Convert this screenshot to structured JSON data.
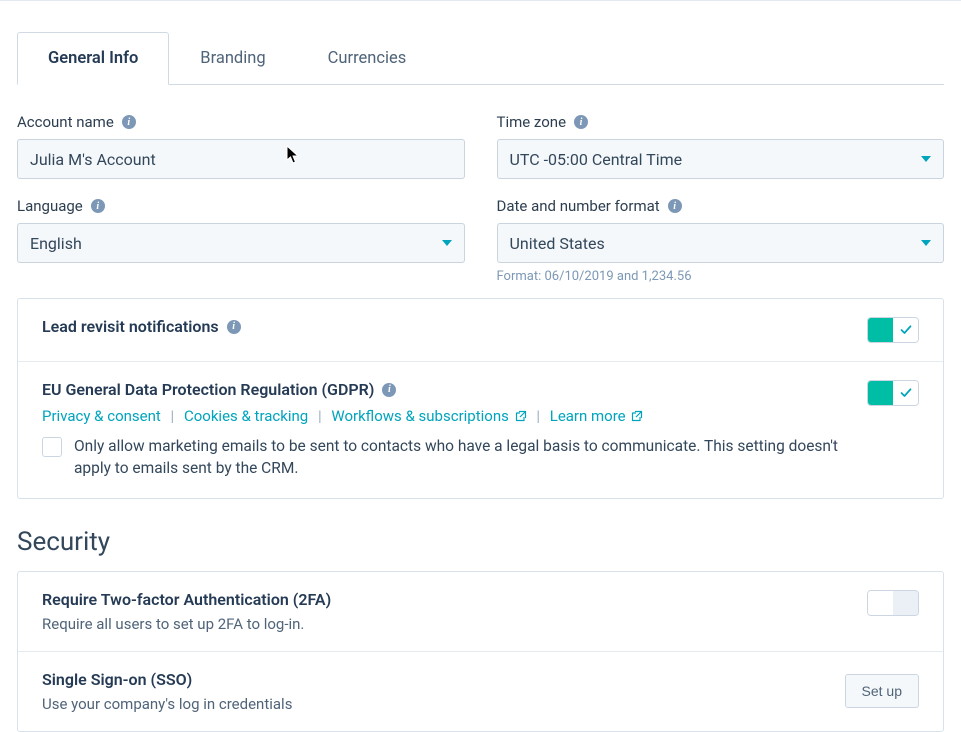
{
  "tabs": {
    "general": "General Info",
    "branding": "Branding",
    "currencies": "Currencies"
  },
  "fields": {
    "account_name": {
      "label": "Account name",
      "value": "Julia M's Account"
    },
    "time_zone": {
      "label": "Time zone",
      "value": "UTC -05:00 Central Time"
    },
    "language": {
      "label": "Language",
      "value": "English"
    },
    "date_format": {
      "label": "Date and number format",
      "value": "United States",
      "helper": "Format: 06/10/2019 and 1,234.56"
    }
  },
  "lead_revisit": {
    "title": "Lead revisit notifications"
  },
  "gdpr": {
    "title": "EU General Data Protection Regulation (GDPR)",
    "links": {
      "privacy": "Privacy & consent",
      "cookies": "Cookies & tracking",
      "workflows": "Workflows & subscriptions",
      "learn_more": "Learn more"
    },
    "checkbox_label": "Only allow marketing emails to be sent to contacts who have a legal basis to communicate. This setting doesn't apply to emails sent by the CRM."
  },
  "security": {
    "heading": "Security",
    "twofa": {
      "title": "Require Two-factor Authentication (2FA)",
      "sub": "Require all users to set up 2FA to log-in."
    },
    "sso": {
      "title": "Single Sign-on (SSO)",
      "sub": "Use your company's log in credentials",
      "button": "Set up"
    }
  }
}
